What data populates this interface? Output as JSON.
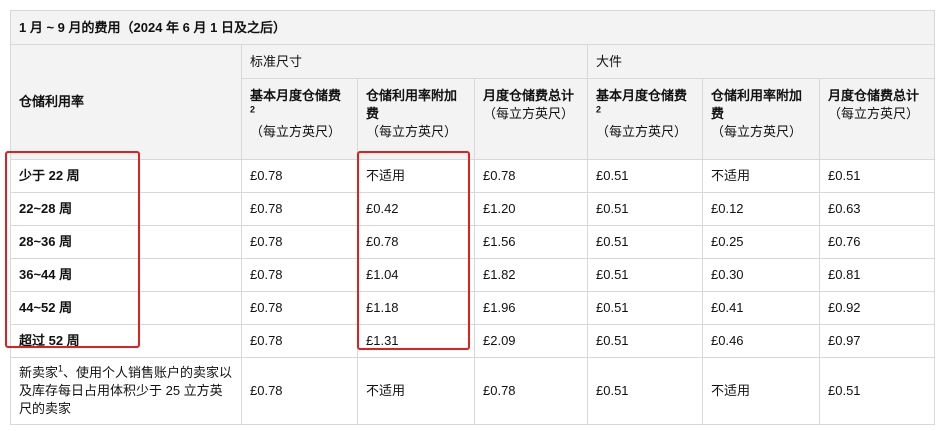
{
  "title": "1 月 ~ 9 月的费用（2024 年 6 月 1 日及之后）",
  "row_header": "仓储利用率",
  "groups": {
    "standard": "标准尺寸",
    "oversize": "大件"
  },
  "columns": {
    "base": "基本月度仓储费",
    "base_sup": "2",
    "surcharge": "仓储利用率附加费",
    "total": "月度仓储费总计",
    "unit": "（每立方英尺）"
  },
  "rows": [
    {
      "label": "少于 22 周",
      "std_base": "£0.78",
      "std_sur": "不适用",
      "std_total": "£0.78",
      "ovr_base": "£0.51",
      "ovr_sur": "不适用",
      "ovr_total": "£0.51"
    },
    {
      "label": "22~28 周",
      "std_base": "£0.78",
      "std_sur": "£0.42",
      "std_total": "£1.20",
      "ovr_base": "£0.51",
      "ovr_sur": "£0.12",
      "ovr_total": "£0.63"
    },
    {
      "label": "28~36 周",
      "std_base": "£0.78",
      "std_sur": "£0.78",
      "std_total": "£1.56",
      "ovr_base": "£0.51",
      "ovr_sur": "£0.25",
      "ovr_total": "£0.76"
    },
    {
      "label": "36~44 周",
      "std_base": "£0.78",
      "std_sur": "£1.04",
      "std_total": "£1.82",
      "ovr_base": "£0.51",
      "ovr_sur": "£0.30",
      "ovr_total": "£0.81"
    },
    {
      "label": "44~52 周",
      "std_base": "£0.78",
      "std_sur": "£1.18",
      "std_total": "£1.96",
      "ovr_base": "£0.51",
      "ovr_sur": "£0.41",
      "ovr_total": "£0.92"
    },
    {
      "label": "超过 52 周",
      "std_base": "£0.78",
      "std_sur": "£1.31",
      "std_total": "£2.09",
      "ovr_base": "£0.51",
      "ovr_sur": "£0.46",
      "ovr_total": "£0.97"
    }
  ],
  "new_seller": {
    "label_a": "新卖家",
    "label_sup": "1",
    "label_b": "、使用个人销售账户的卖家以及库存每日占用体积少于 25 立方英尺的卖家",
    "std_base": "£0.78",
    "std_sur": "不适用",
    "std_total": "£0.78",
    "ovr_base": "£0.51",
    "ovr_sur": "不适用",
    "ovr_total": "£0.51"
  },
  "highlight_color": "#e0201f"
}
